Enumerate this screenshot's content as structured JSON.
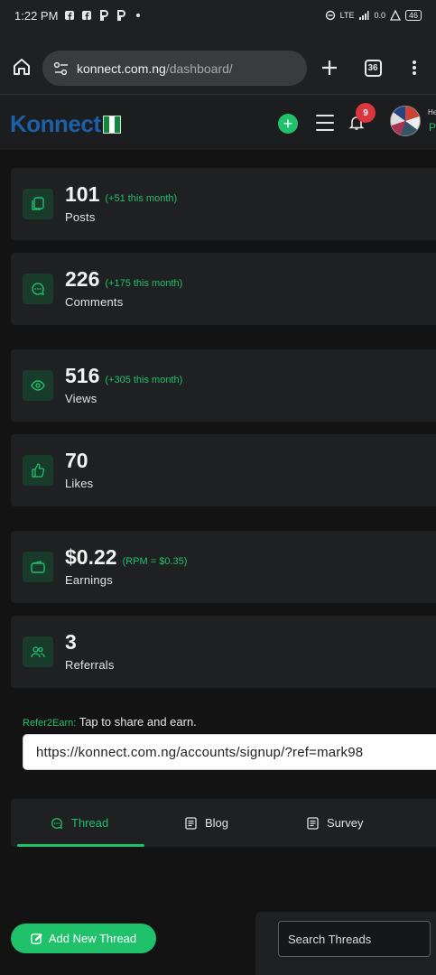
{
  "status_bar": {
    "time": "1:22 PM",
    "notification_icons": [
      "facebook-icon",
      "facebook-icon",
      "pinterest-icon",
      "pinterest-icon",
      "dot-icon"
    ],
    "network": "LTE",
    "data_speed": "0.0",
    "battery": "46"
  },
  "browser": {
    "url_host": "konnect.com.ng",
    "url_path": "/dashboard/",
    "tab_count": "36"
  },
  "header": {
    "logo_text": "Konnect",
    "notification_count": "9",
    "greeting": "He",
    "user_initial": "P"
  },
  "stats": [
    {
      "value": "101",
      "delta": "(+51 this month)",
      "label": "Posts",
      "icon": "posts-icon"
    },
    {
      "value": "226",
      "delta": "(+175 this month)",
      "label": "Comments",
      "icon": "comment-icon"
    },
    {
      "value": "516",
      "delta": "(+305 this month)",
      "label": "Views",
      "icon": "eye-icon"
    },
    {
      "value": "70",
      "delta": "",
      "label": "Likes",
      "icon": "thumbs-up-icon"
    },
    {
      "value": "$0.22",
      "delta": "(RPM = $0.35)",
      "label": "Earnings",
      "icon": "wallet-icon"
    },
    {
      "value": "3",
      "delta": "",
      "label": "Referrals",
      "icon": "users-icon"
    }
  ],
  "referral": {
    "tag": "Refer2Earn:",
    "text": "Tap to share and earn.",
    "link": "https://konnect.com.ng/accounts/signup/?ref=mark98"
  },
  "tabs": [
    {
      "label": "Thread",
      "active": true
    },
    {
      "label": "Blog",
      "active": false
    },
    {
      "label": "Survey",
      "active": false
    }
  ],
  "actions": {
    "add_thread": "Add New Thread",
    "search_placeholder": "Search Threads"
  },
  "colors": {
    "accent": "#1fc16b",
    "background": "#131313",
    "card": "#1f2022",
    "badge": "#d9363e"
  }
}
